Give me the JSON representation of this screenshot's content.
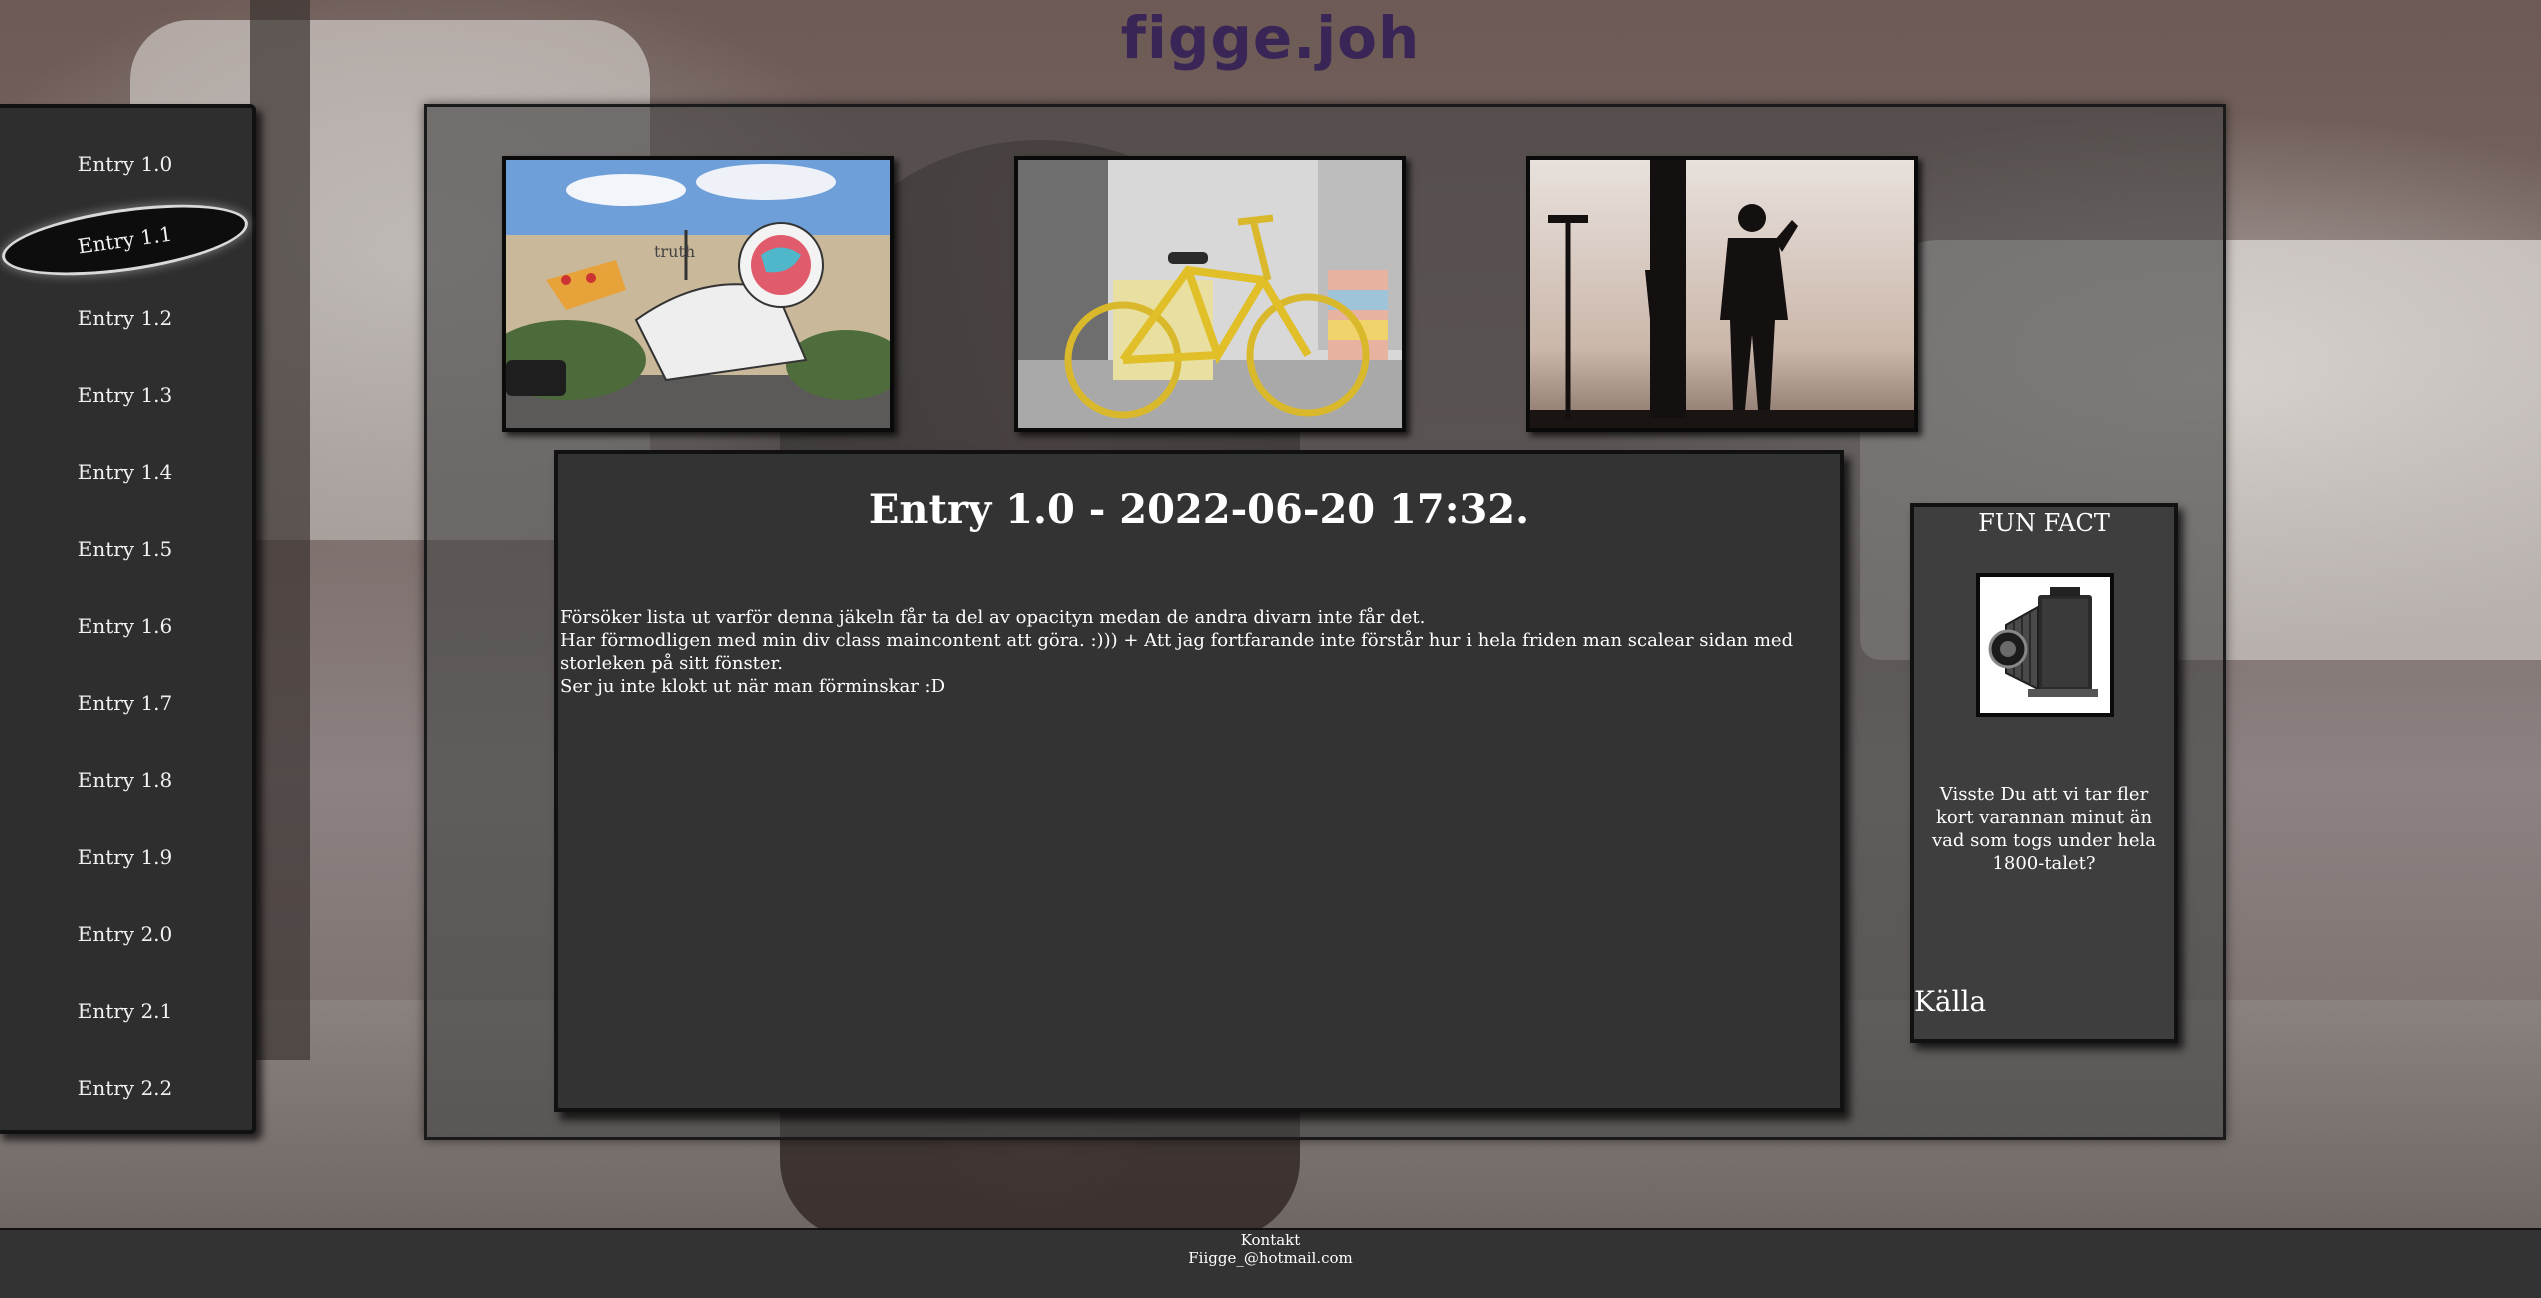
{
  "header": {
    "title": "figge.joh"
  },
  "sidebar": {
    "items": [
      {
        "label": "Entry 1.0"
      },
      {
        "label": "Entry 1.1"
      },
      {
        "label": "Entry 1.2"
      },
      {
        "label": "Entry 1.3"
      },
      {
        "label": "Entry 1.4"
      },
      {
        "label": "Entry 1.5"
      },
      {
        "label": "Entry 1.6"
      },
      {
        "label": "Entry 1.7"
      },
      {
        "label": "Entry 1.8"
      },
      {
        "label": "Entry 1.9"
      },
      {
        "label": "Entry 2.0"
      },
      {
        "label": "Entry 2.1"
      },
      {
        "label": "Entry 2.2"
      }
    ],
    "active_index": 1
  },
  "gallery": {
    "images": [
      {
        "name": "astronaut-pizza-mural-image",
        "wall_text": "truth"
      },
      {
        "name": "yellow-bicycle-image"
      },
      {
        "name": "silhouette-photographer-image"
      }
    ]
  },
  "main": {
    "title": "Entry 1.0 - 2022-06-20 17:32.",
    "paragraphs": [
      "Försöker lista ut varför denna jäkeln får ta del av opacityn medan de andra divarn inte får det.",
      "Har förmodligen med min div class maincontent att göra. :))) + Att jag fortfarande inte förstår hur i hela friden man scalear sidan med storleken på sitt fönster.",
      "Ser ju inte klokt ut när man förminskar :D"
    ]
  },
  "fun_fact": {
    "title": "FUN FACT",
    "image_icon": "folding-camera-icon",
    "text": "Visste Du att vi tar fler kort varannan minut än vad som togs under hela 1800-talet?",
    "source_label": "Källa"
  },
  "footer": {
    "contact_label": "Kontakt",
    "email": "Fiigge_@hotmail.com"
  },
  "colors": {
    "title": "#3a2656",
    "panel": "#333333",
    "sidebar": "#2e2e2e"
  }
}
